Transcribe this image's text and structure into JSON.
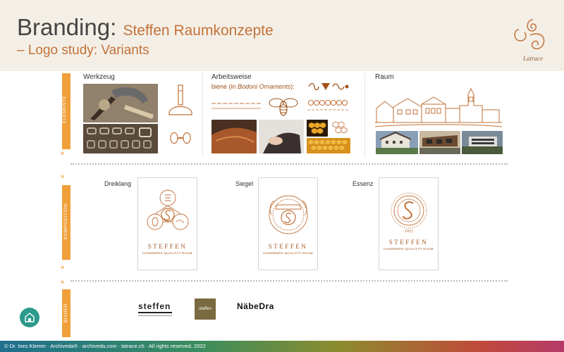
{
  "header": {
    "title_main": "Branding:",
    "title_sub": "Steffen Raumkonzepte",
    "subtitle": "– Logo study: Variants",
    "brand_logo_text": "Latrace"
  },
  "bands": {
    "elemente": "ELEMENTE",
    "komposition": "KOMPOSITION",
    "bisher": "BISHER"
  },
  "sections": {
    "werkzeug": "Werkzeug",
    "arbeitsweise": "Arbeitsweise",
    "ornament_prefix": "biene (in ",
    "ornament_italic": "Bodoni Ornaments",
    "ornament_suffix": "):",
    "raum": "Raum"
  },
  "compositions": [
    {
      "label": "Dreiklang",
      "name": "STEFFEN",
      "tagline": "HANDWERK QUALITÄT RAUM"
    },
    {
      "label": "Siegel",
      "name": "STEFFEN",
      "tagline": "HANDWERK QUALITÄT RAUM"
    },
    {
      "label": "Essenz",
      "name": "STEFFEN",
      "tagline": "HANDWERK QUALITÄT RAUM",
      "year": "1912"
    }
  ],
  "bisher_logos": {
    "logo1_name": "steffen",
    "logo2_name": "steffen",
    "logo3_name": "NäbeDra"
  },
  "colors": {
    "accent": "#c2723a",
    "band": "#f0a03a",
    "header_bg": "#f4efe6",
    "home_button": "#2b9a8c"
  },
  "footer": {
    "text": "© Dr. Ines Klemm · Archiveda® · archiveda.com · latrace.ch · All rights reserved. 2022"
  }
}
